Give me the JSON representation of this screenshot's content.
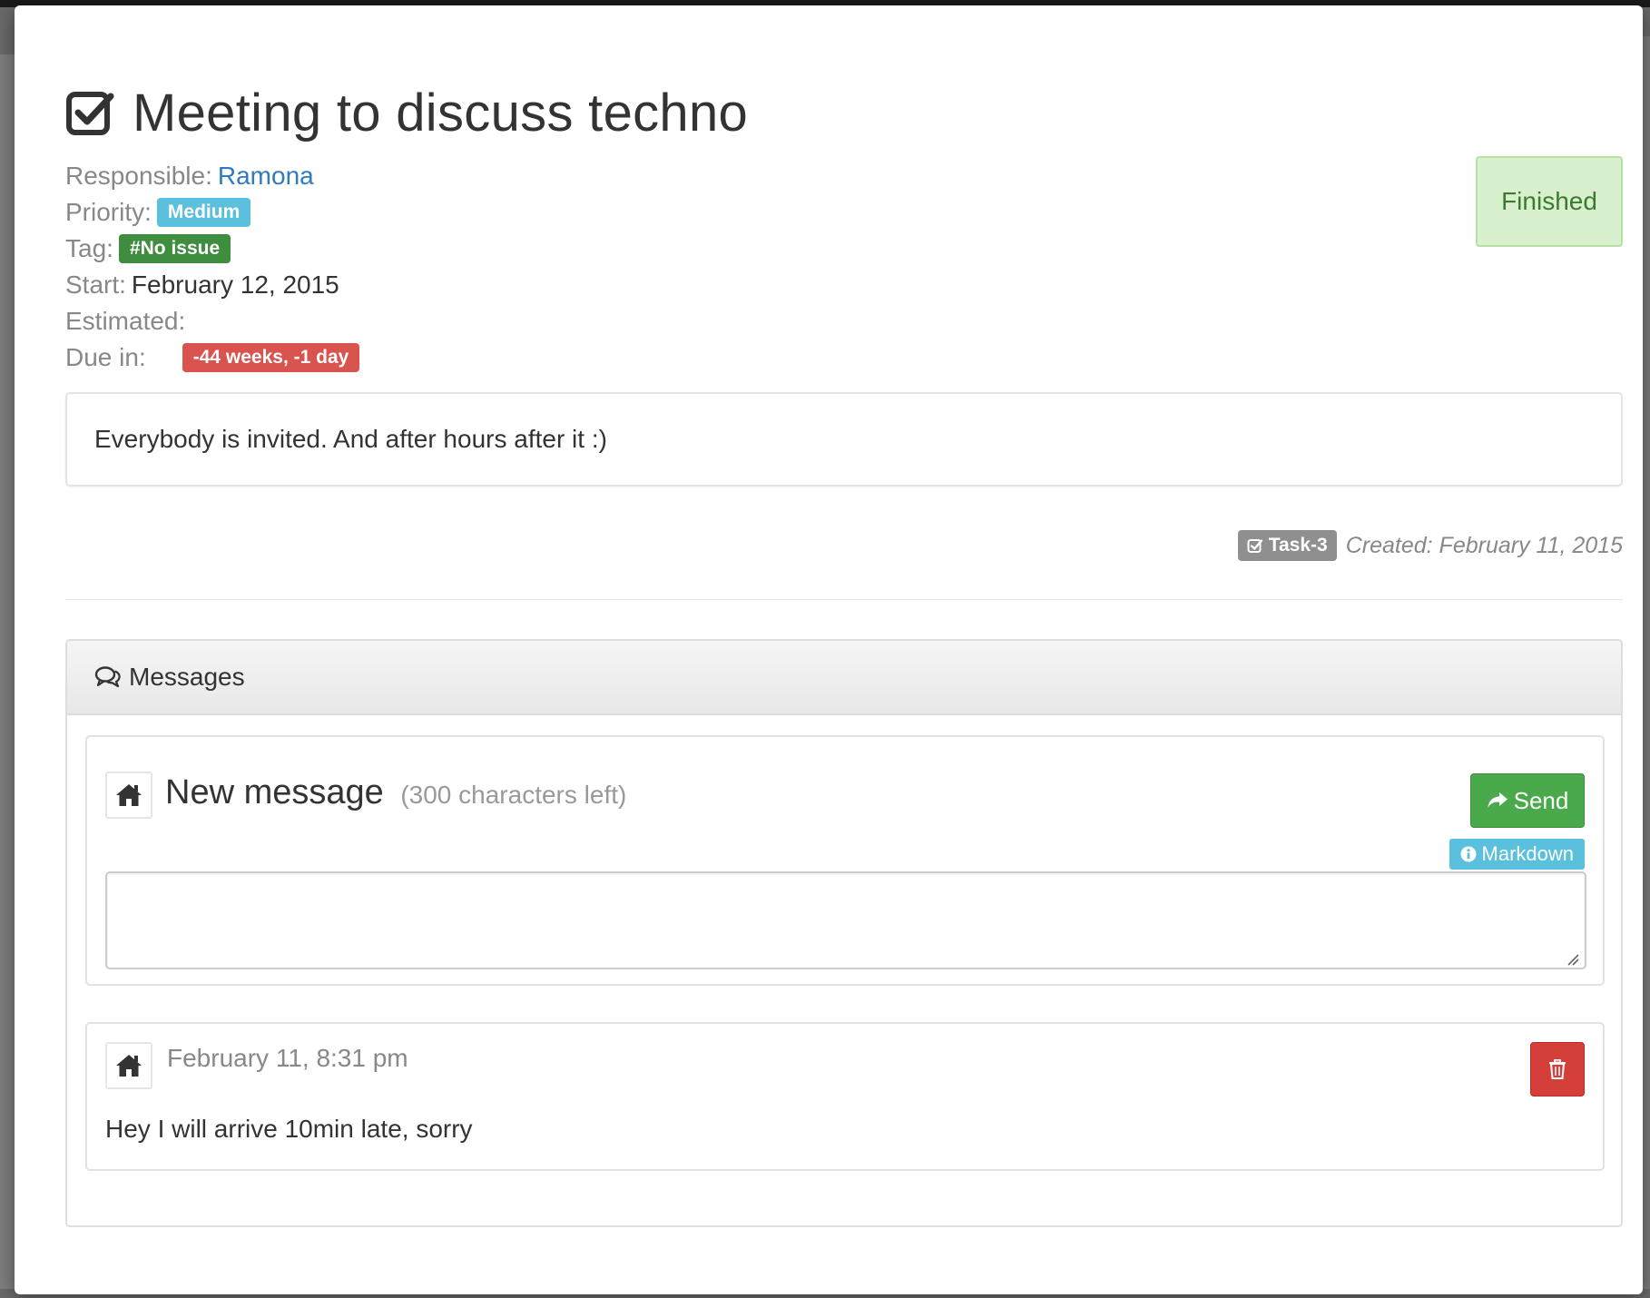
{
  "task": {
    "title": "Meeting to discuss techno",
    "responsible_label": "Responsible:",
    "responsible": "Ramona",
    "priority_label": "Priority:",
    "priority": "Medium",
    "tag_label": "Tag:",
    "tag": "#No issue",
    "start_label": "Start:",
    "start": "February 12, 2015",
    "estimated_label": "Estimated:",
    "due_label": "Due in:",
    "due": "-44 weeks, -1 day",
    "status": "Finished",
    "description": "Everybody is invited. And after hours after it :)",
    "id": "Task-3",
    "created": "Created: February 11, 2015"
  },
  "messages": {
    "header": "Messages",
    "new_message_title": "New message",
    "chars_left": "(300 characters left)",
    "send_label": "Send",
    "markdown_label": "Markdown",
    "textarea_value": "",
    "items": [
      {
        "date": "February 11, 8:31 pm",
        "text": "Hey I will arrive 10min late, sorry"
      }
    ]
  },
  "colors": {
    "link": "#2e7bbf",
    "info": "#5bc0de",
    "success": "#3f8e3f",
    "danger": "#d9534f",
    "status_bg": "#d8f0cd"
  },
  "icons": {
    "title": "checkbox-checked-icon",
    "messages": "comments-icon",
    "avatar": "home-icon",
    "send": "share-arrow-icon",
    "markdown": "info-circle-icon",
    "delete": "trash-icon",
    "task": "checkbox-checked-icon"
  }
}
